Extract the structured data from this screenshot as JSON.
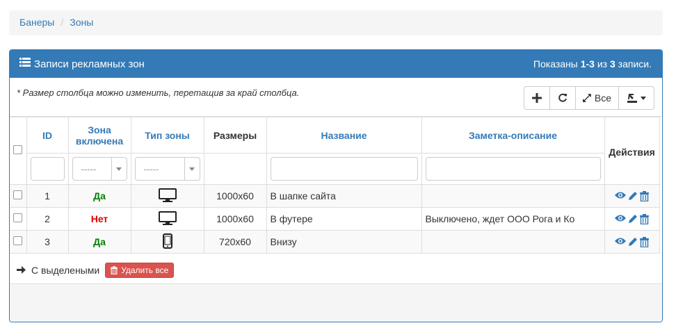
{
  "breadcrumb": {
    "items": [
      "Банеры",
      "Зоны"
    ],
    "separator": "/"
  },
  "panel": {
    "title": "Записи рекламных зон",
    "summary_prefix": "Показаны ",
    "summary_range": "1-3",
    "summary_mid": " из ",
    "summary_total": "3",
    "summary_suffix": " записи."
  },
  "toolbar": {
    "hint": "* Размер столбца можно изменить, перетащив за край столбца.",
    "all_label": "Все"
  },
  "columns": {
    "id": "ID",
    "enabled_line1": "Зона",
    "enabled_line2": "включена",
    "type": "Тип зоны",
    "sizes": "Размеры",
    "name": "Название",
    "note": "Заметка-описание",
    "actions": "Действия"
  },
  "filters": {
    "select_placeholder": "-----"
  },
  "rows": [
    {
      "id": "1",
      "enabled": "Да",
      "type": "desktop-icon",
      "size": "1000x60",
      "name": "В шапке сайта",
      "note": ""
    },
    {
      "id": "2",
      "enabled": "Нет",
      "type": "desktop-icon",
      "size": "1000x60",
      "name": "В футере",
      "note": "Выключено, ждет ООО Рога и Ко"
    },
    {
      "id": "3",
      "enabled": "Да",
      "type": "mobile-icon",
      "size": "720x60",
      "name": "Внизу",
      "note": ""
    }
  ],
  "bulk": {
    "label": "С выделеными",
    "delete_label": "Удалить все"
  },
  "colors": {
    "primary": "#337ab7",
    "success": "#008000",
    "danger": "#d9534f",
    "no_text": "#e00000"
  }
}
